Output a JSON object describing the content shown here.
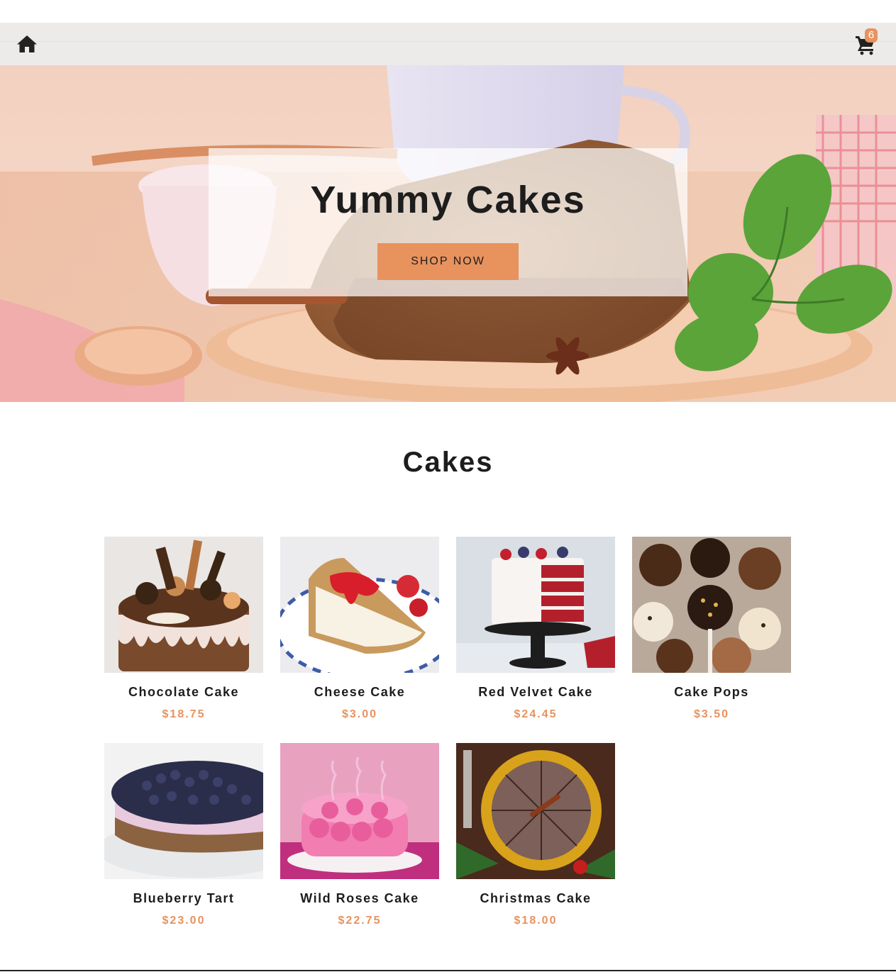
{
  "navbar": {
    "home_icon": "home-icon",
    "cart_icon": "cart-icon",
    "cart_count": "6"
  },
  "hero": {
    "title": "Yummy Cakes",
    "button_label": "SHOP NOW"
  },
  "section": {
    "title": "Cakes"
  },
  "products": [
    {
      "name": "Chocolate Cake",
      "price": "$18.75"
    },
    {
      "name": "Cheese Cake",
      "price": "$3.00"
    },
    {
      "name": "Red Velvet Cake",
      "price": "$24.45"
    },
    {
      "name": "Cake Pops",
      "price": "$3.50"
    },
    {
      "name": "Blueberry Tart",
      "price": "$23.00"
    },
    {
      "name": "Wild Roses Cake",
      "price": "$22.75"
    },
    {
      "name": "Christmas Cake",
      "price": "$18.00"
    }
  ],
  "colors": {
    "accent": "#e8925e",
    "navbar_bg": "#ece9e9",
    "text": "#1d1d1d"
  }
}
